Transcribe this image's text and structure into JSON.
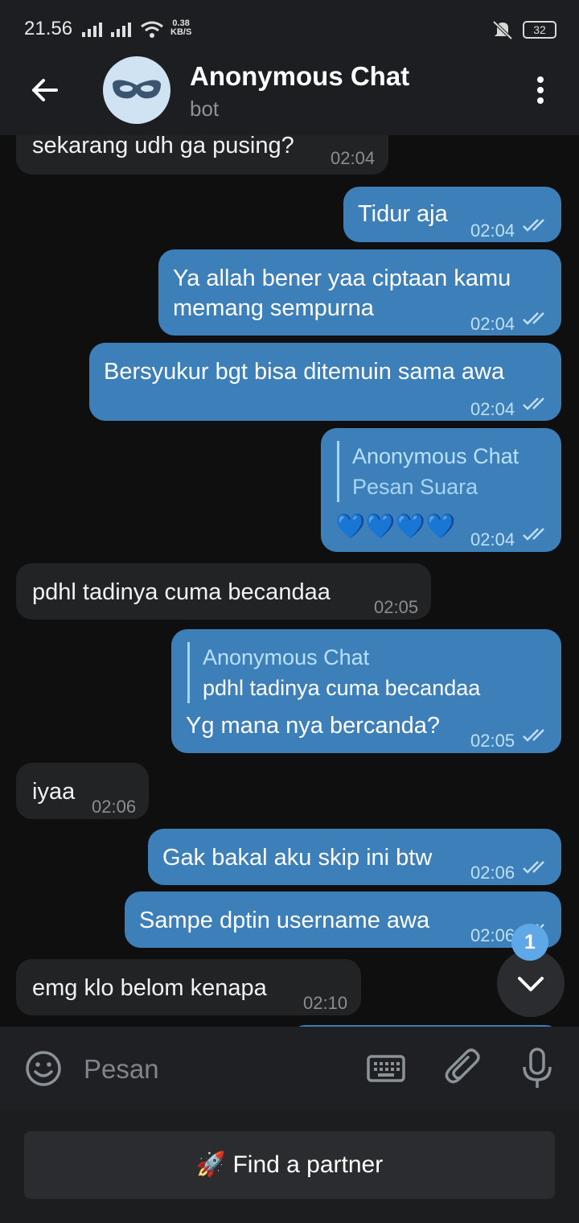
{
  "status": {
    "time": "21.56",
    "net_speed_value": "0.38",
    "net_speed_unit": "KB/S",
    "battery": "32"
  },
  "header": {
    "title": "Anonymous Chat",
    "subtitle": "bot"
  },
  "messages": {
    "m0": {
      "text": "sekarang udh ga pusing?",
      "time": "02:04"
    },
    "m1": {
      "text": "Tidur aja",
      "time": "02:04"
    },
    "m2": {
      "line1": "Ya allah bener yaa ciptaan kamu",
      "line2": "memang sempurna",
      "time": "02:04"
    },
    "m3": {
      "text": "Bersyukur bgt bisa ditemuin sama awa",
      "time": "02:04"
    },
    "m4": {
      "reply_name": "Anonymous Chat",
      "reply_text": "Pesan Suara",
      "text": "💙💙💙💙",
      "time": "02:04"
    },
    "m5": {
      "text": "pdhl tadinya cuma becandaa",
      "time": "02:05"
    },
    "m6": {
      "reply_name": "Anonymous Chat",
      "reply_text": "pdhl tadinya cuma becandaa",
      "text": "Yg mana nya bercanda?",
      "time": "02:05"
    },
    "m7": {
      "text": "iyaa",
      "time": "02:06"
    },
    "m8": {
      "text": "Gak bakal aku skip ini btw",
      "time": "02:06"
    },
    "m9": {
      "text": "Sampe dptin username awa",
      "time": "02:06"
    },
    "m10": {
      "text": "emg klo belom kenapa",
      "time": "02:10"
    }
  },
  "scroll": {
    "unread_count": "1"
  },
  "input": {
    "placeholder": "Pesan"
  },
  "bottom": {
    "find_partner_label": "🚀 Find a partner"
  },
  "colors": {
    "outgoing_bubble": "#3d7fb8",
    "incoming_bubble": "#222325",
    "header_bg": "#1c1e21",
    "accent": "#5ea8e8"
  },
  "icons": [
    "back-arrow-icon",
    "mask-icon",
    "more-vert-icon",
    "emoji-icon",
    "keyboard-icon",
    "attach-icon",
    "mic-icon",
    "chevron-down-icon",
    "double-check-icon",
    "signal-icon",
    "wifi-icon",
    "mute-icon"
  ]
}
